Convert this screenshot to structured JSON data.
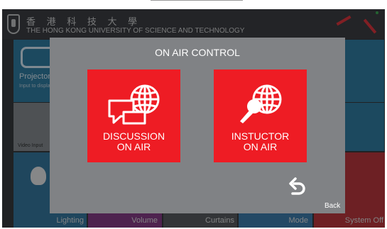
{
  "header": {
    "university_cn": "香 港 科 技 大 學",
    "university_en": "THE HONG KONG UNIVERSITY OF SCIENCE AND TECHNOLOGY"
  },
  "background_tiles": {
    "projector": {
      "label": "Projector",
      "sub": "Input to display..."
    },
    "video_label": "Video Input",
    "bottom": [
      {
        "label": "Lighting",
        "icon": "lightbulb-icon"
      },
      {
        "label": "Volume",
        "icon": "speaker-icon"
      },
      {
        "label": "Curtains",
        "icon": "curtain-icon"
      },
      {
        "label": "Mode",
        "icon": "camera-icon"
      },
      {
        "label": "System Off",
        "icon": "power-icon"
      }
    ]
  },
  "modal": {
    "title": "ON AIR CONTROL",
    "discussion_line1": "DISCUSSION",
    "discussion_line2": "ON AIR",
    "instructor_line1": "INSTUCTOR",
    "instructor_line2": "ON AIR",
    "back_label": "Back"
  },
  "colors": {
    "accent_red": "#ee1c24",
    "modal_gray": "#808285",
    "tile_blue": "#1f6f96"
  }
}
